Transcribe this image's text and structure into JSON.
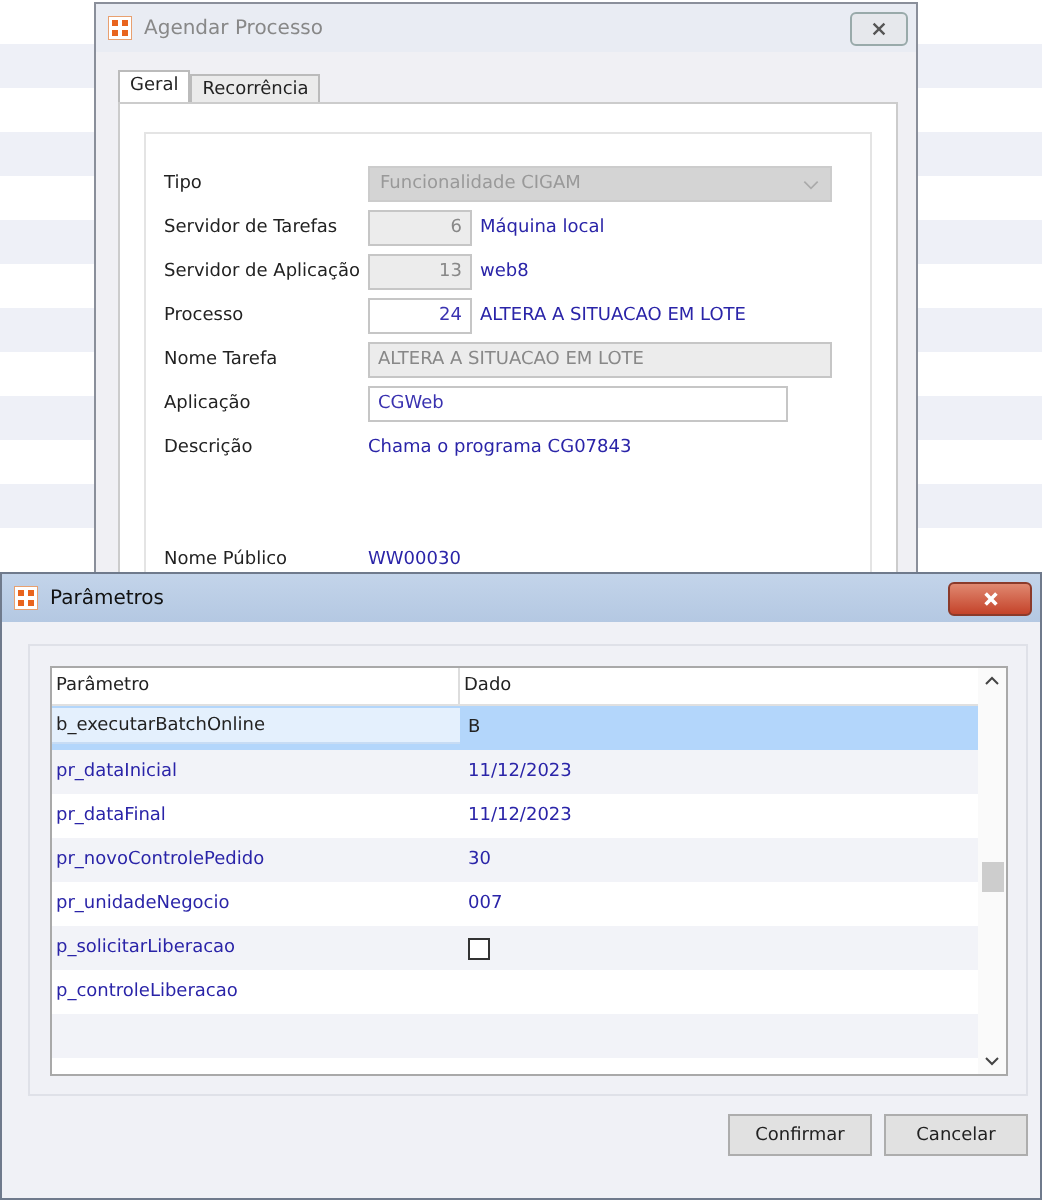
{
  "back_window": {
    "title": "Agendar Processo",
    "tabs": [
      {
        "label": "Geral",
        "selected": true
      },
      {
        "label": "Recorrência",
        "selected": false
      }
    ],
    "fields": [
      {
        "kind": "dropdown",
        "label": "Tipo",
        "value": "Funcionalidade CIGAM",
        "disabled": true
      },
      {
        "kind": "code",
        "label": "Servidor de Tarefas",
        "value": "6",
        "disabled": true,
        "description": "Máquina local"
      },
      {
        "kind": "code",
        "label": "Servidor de Aplicação",
        "value": "13",
        "disabled": true,
        "description": "web8"
      },
      {
        "kind": "code",
        "label": "Processo",
        "value": "24",
        "disabled": false,
        "description": "ALTERA A SITUACAO EM LOTE"
      },
      {
        "kind": "text",
        "label": "Nome Tarefa",
        "value": "ALTERA A SITUACAO EM LOTE",
        "disabled": true
      },
      {
        "kind": "text",
        "label": "Aplicação",
        "value": "CGWeb",
        "disabled": false
      },
      {
        "kind": "info",
        "label": "Descrição",
        "value": "Chama o programa CG07843"
      },
      {
        "kind": "gap"
      },
      {
        "kind": "info",
        "label": "Nome Público",
        "value": "WW00030"
      }
    ]
  },
  "params_window": {
    "title": "Parâmetros",
    "table": {
      "columns": [
        "Parâmetro",
        "Dado"
      ],
      "rows": [
        {
          "kind": "text",
          "name": "b_executarBatchOnline",
          "value": "B",
          "selected": true
        },
        {
          "kind": "text",
          "name": "pr_dataInicial",
          "value": "11/12/2023",
          "selected": false
        },
        {
          "kind": "text",
          "name": "pr_dataFinal",
          "value": "11/12/2023",
          "selected": false
        },
        {
          "kind": "text",
          "name": "pr_novoControlePedido",
          "value": "30",
          "selected": false
        },
        {
          "kind": "text",
          "name": "pr_unidadeNegocio",
          "value": "007",
          "selected": false
        },
        {
          "kind": "checkbox",
          "name": "p_solicitarLiberacao",
          "checked": false,
          "selected": false
        },
        {
          "kind": "text",
          "name": "p_controleLiberacao",
          "selected": false
        }
      ]
    },
    "buttons": [
      "Confirmar",
      "Cancelar"
    ]
  }
}
